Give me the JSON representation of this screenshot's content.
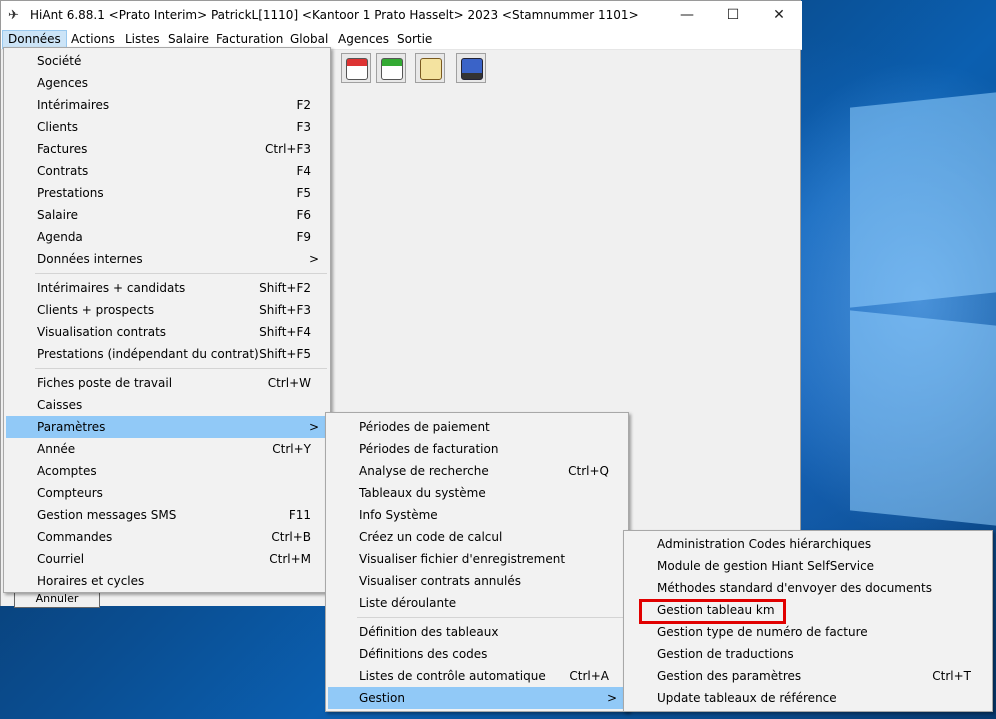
{
  "window": {
    "title": "HiAnt 6.88.1 <Prato Interim> PatrickL[1110] <Kantoor 1 Prato Hasselt> 2023 <Stamnummer 1101>",
    "app_icon": "ant-icon",
    "minimize_glyph": "—",
    "maximize_glyph": "☐",
    "close_glyph": "✕"
  },
  "menubar": [
    "Données",
    "Actions",
    "Listes",
    "Salaire",
    "Facturation",
    "Global",
    "Agences",
    "Sortie"
  ],
  "toolbar_icons": [
    "calendar-30-icon",
    "calendar-60-icon",
    "clipboard-icon",
    "truck-icon"
  ],
  "background_button": "Annuler",
  "menu_donnees": {
    "items": [
      {
        "label": "Société",
        "shortcut": ""
      },
      {
        "label": "Agences",
        "shortcut": ""
      },
      {
        "label": "Intérimaires",
        "shortcut": "F2"
      },
      {
        "label": "Clients",
        "shortcut": "F3"
      },
      {
        "label": "Factures",
        "shortcut": "Ctrl+F3"
      },
      {
        "label": "Contrats",
        "shortcut": "F4"
      },
      {
        "label": "Prestations",
        "shortcut": "F5"
      },
      {
        "label": "Salaire",
        "shortcut": "F6"
      },
      {
        "label": "Agenda",
        "shortcut": "F9"
      },
      {
        "label": "Données internes",
        "shortcut": "",
        "submenu": ">"
      },
      {
        "label": "Intérimaires + candidats",
        "shortcut": "Shift+F2"
      },
      {
        "label": "Clients + prospects",
        "shortcut": "Shift+F3"
      },
      {
        "label": "Visualisation contrats",
        "shortcut": "Shift+F4"
      },
      {
        "label": "Prestations (indépendant du contrat)",
        "shortcut": "Shift+F5"
      },
      {
        "label": "Fiches poste de travail",
        "shortcut": "Ctrl+W"
      },
      {
        "label": "Caisses",
        "shortcut": ""
      },
      {
        "label": "Paramètres",
        "shortcut": "",
        "submenu": ">",
        "highlighted": true
      },
      {
        "label": "Année",
        "shortcut": "Ctrl+Y"
      },
      {
        "label": "Acomptes",
        "shortcut": ""
      },
      {
        "label": "Compteurs",
        "shortcut": ""
      },
      {
        "label": "Gestion messages SMS",
        "shortcut": "F11"
      },
      {
        "label": "Commandes",
        "shortcut": "Ctrl+B"
      },
      {
        "label": "Courriel",
        "shortcut": "Ctrl+M"
      },
      {
        "label": "Horaires et cycles",
        "shortcut": ""
      }
    ]
  },
  "menu_parametres": {
    "items": [
      {
        "label": "Périodes de paiement",
        "shortcut": ""
      },
      {
        "label": "Périodes de facturation",
        "shortcut": ""
      },
      {
        "label": "Analyse de recherche",
        "shortcut": "Ctrl+Q"
      },
      {
        "label": "Tableaux du système",
        "shortcut": ""
      },
      {
        "label": "Info Système",
        "shortcut": ""
      },
      {
        "label": "Créez un code de calcul",
        "shortcut": ""
      },
      {
        "label": "Visualiser fichier d'enregistrement",
        "shortcut": ""
      },
      {
        "label": "Visualiser contrats annulés",
        "shortcut": ""
      },
      {
        "label": "Liste déroulante",
        "shortcut": ""
      },
      {
        "label": "Définition des tableaux",
        "shortcut": ""
      },
      {
        "label": " Définitions des codes",
        "shortcut": ""
      },
      {
        "label": "Listes de contrôle automatique",
        "shortcut": "Ctrl+A"
      },
      {
        "label": "Gestion",
        "shortcut": "",
        "submenu": ">",
        "highlighted": true
      }
    ]
  },
  "menu_gestion": {
    "items": [
      {
        "label": "Administration Codes hiérarchiques",
        "shortcut": ""
      },
      {
        "label": "Module de gestion Hiant SelfService",
        "shortcut": ""
      },
      {
        "label": "Méthodes standard d'envoyer des documents",
        "shortcut": ""
      },
      {
        "label": "Gestion tableau km",
        "shortcut": "",
        "outlined": true
      },
      {
        "label": "Gestion type de numéro de facture",
        "shortcut": ""
      },
      {
        "label": "Gestion de traductions",
        "shortcut": ""
      },
      {
        "label": "Gestion des paramètres",
        "shortcut": "Ctrl+T"
      },
      {
        "label": "Update tableaux de référence",
        "shortcut": ""
      }
    ]
  },
  "colors": {
    "highlight": "#91c9f7",
    "annotation_outline": "#e10000",
    "menubar_active": "#cce4f7"
  }
}
